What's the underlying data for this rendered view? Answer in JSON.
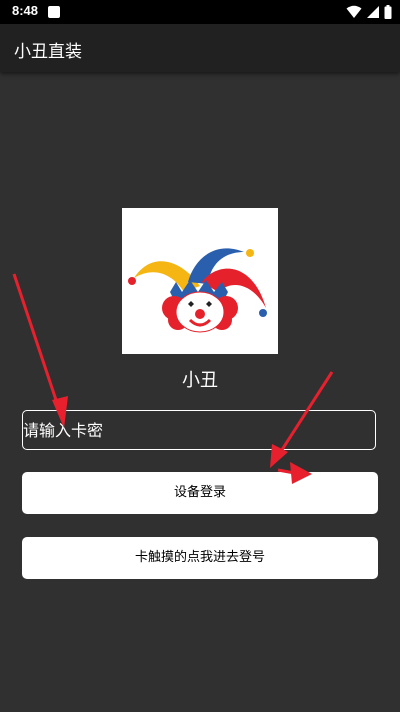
{
  "status_bar": {
    "time": "8:48",
    "icons": [
      "notification-icon",
      "wifi-icon",
      "signal-icon",
      "battery-icon"
    ]
  },
  "app_bar": {
    "title": "小丑直装"
  },
  "logo": {
    "icon": "jester-clown-icon"
  },
  "app_name": "小丑",
  "card_input": {
    "value": "",
    "placeholder": "请输入卡密"
  },
  "buttons": {
    "device_login": "设备登录",
    "stuck_login": "卡触摸的点我进去登号"
  },
  "colors": {
    "background": "#303030",
    "app_bar": "#212121",
    "status_bar": "#000000",
    "button_bg": "#ffffff",
    "annotation_arrow": "#e8202e"
  }
}
